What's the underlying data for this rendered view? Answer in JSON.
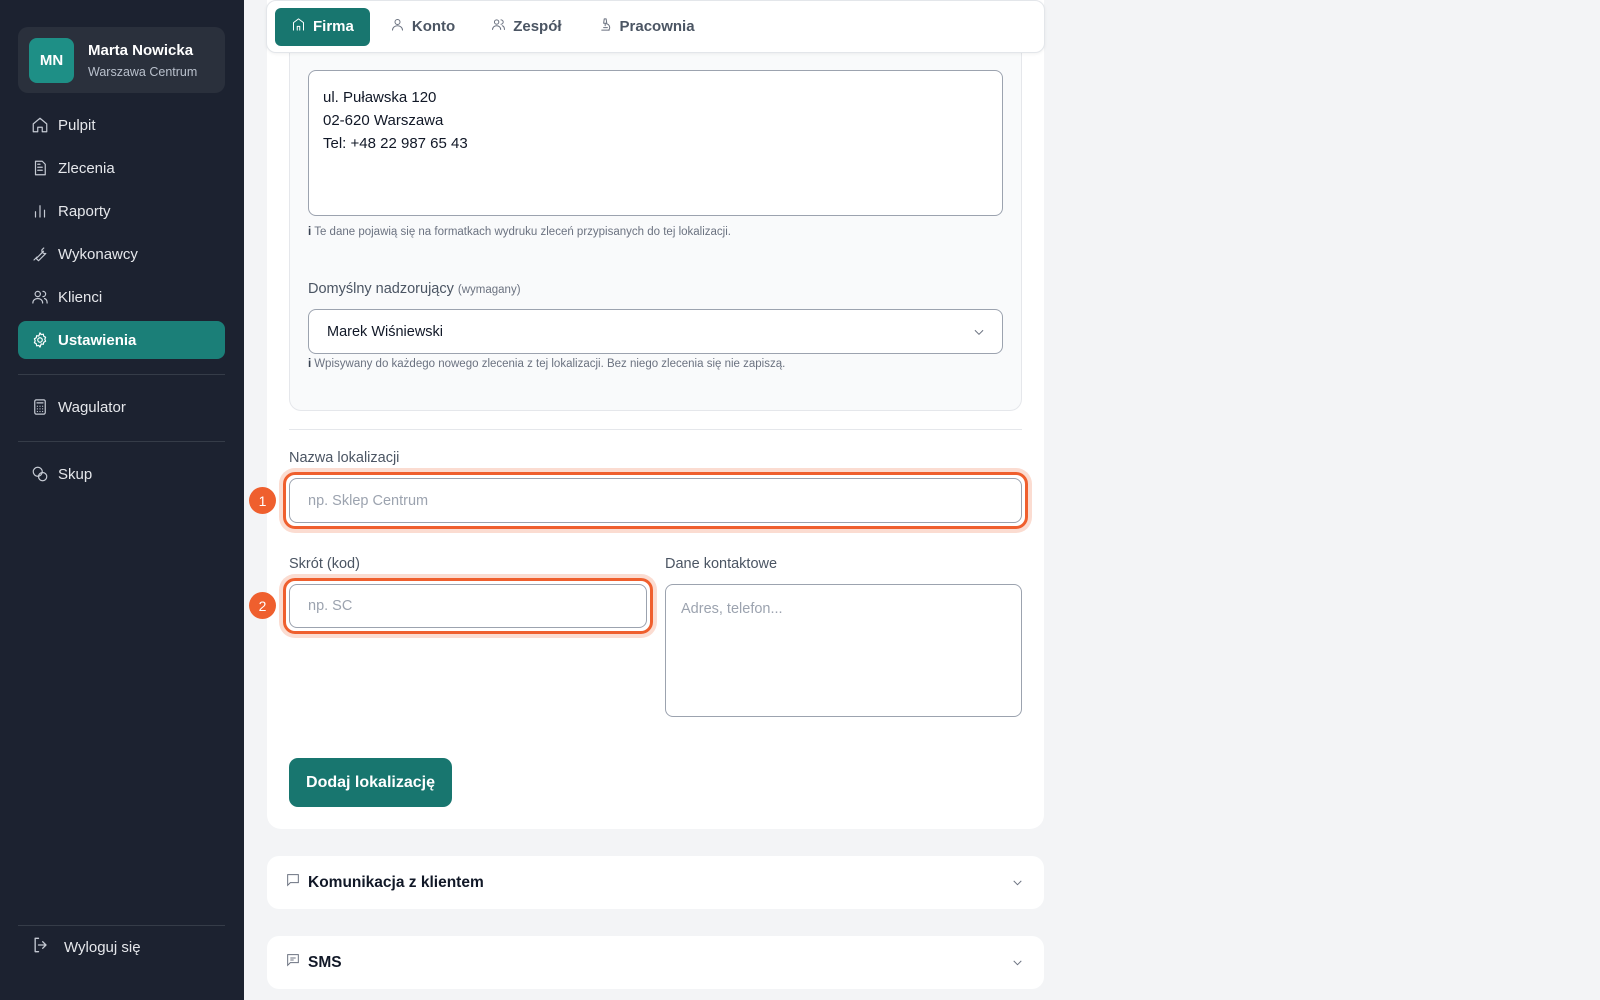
{
  "user": {
    "initials": "MN",
    "name": "Marta Nowicka",
    "location": "Warszawa Centrum"
  },
  "sidebar": {
    "items": [
      {
        "label": "Pulpit",
        "icon": "home-icon"
      },
      {
        "label": "Zlecenia",
        "icon": "document-icon"
      },
      {
        "label": "Raporty",
        "icon": "bar-chart-icon"
      },
      {
        "label": "Wykonawcy",
        "icon": "wrench-icon"
      },
      {
        "label": "Klienci",
        "icon": "users-icon"
      },
      {
        "label": "Ustawienia",
        "icon": "gear-icon",
        "active": true
      }
    ],
    "extra1": {
      "label": "Wagulator",
      "icon": "calculator-icon"
    },
    "extra2": {
      "label": "Skup",
      "icon": "coins-icon"
    },
    "logout": "Wyloguj się"
  },
  "tabs": [
    {
      "label": "Firma",
      "active": true
    },
    {
      "label": "Konto"
    },
    {
      "label": "Zespół"
    },
    {
      "label": "Pracownia"
    }
  ],
  "location_form": {
    "address_text": "ul. Puławska 120\n02-620 Warszawa\nTel: +48 22 987 65 43",
    "address_hint_icon": "i",
    "address_hint": "Te dane pojawią się na formatkach wydruku zleceń przypisanych do tej lokalizacji.",
    "supervisor_label": "Domyślny nadzorujący",
    "supervisor_required": "(wymagany)",
    "supervisor_value": "Marek Wiśniewski",
    "supervisor_hint_icon": "i",
    "supervisor_hint": "Wpisywany do każdego nowego zlecenia z tej lokalizacji. Bez niego zlecenia się nie zapiszą.",
    "name_label": "Nazwa lokalizacji",
    "name_placeholder": "np. Sklep Centrum",
    "code_label": "Skrót (kod)",
    "code_placeholder": "np. SC",
    "contact_label": "Dane kontaktowe",
    "contact_placeholder": "Adres, telefon...",
    "add_button": "Dodaj lokalizację"
  },
  "annotations": {
    "badge1": "1",
    "badge2": "2",
    "color": "#ef5f2e"
  },
  "sections": [
    {
      "title": "Komunikacja z klientem",
      "icon": "chat-icon"
    },
    {
      "title": "SMS",
      "icon": "message-icon"
    }
  ],
  "colors": {
    "accent": "#18766f",
    "sidebar_bg": "#1c2230",
    "highlight": "#ef5f2e"
  }
}
